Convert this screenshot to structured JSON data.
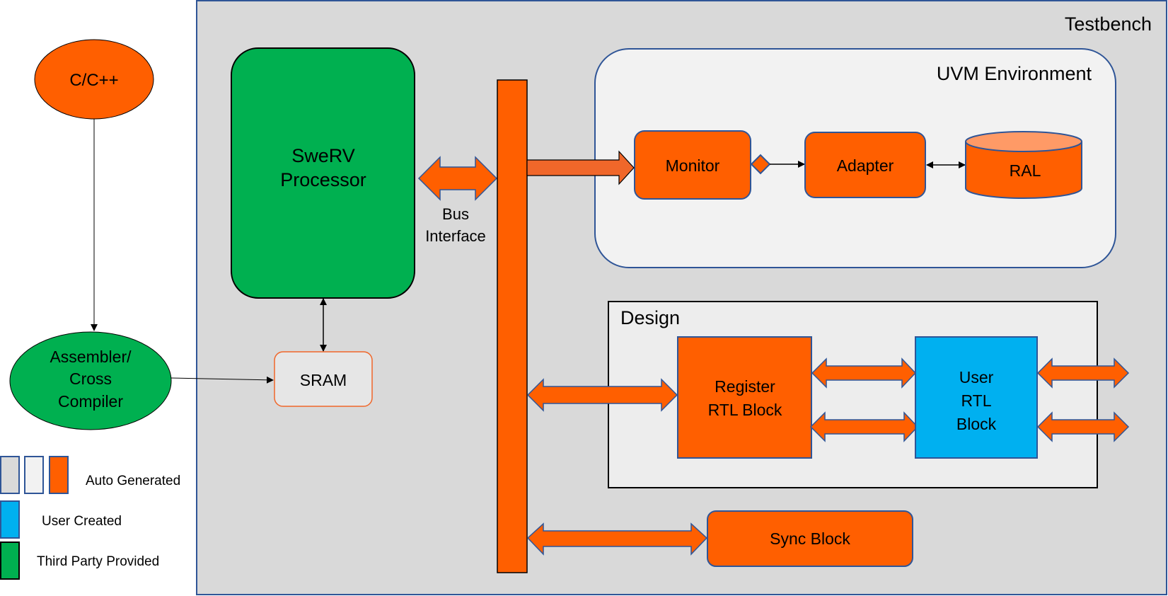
{
  "colors": {
    "orange": "#ff5f00",
    "green": "#00b050",
    "blue": "#00b0f0",
    "testbench_bg": "#d9d9d9",
    "uvm_bg": "#f2f2f2",
    "design_bg": "#ededed",
    "border_blue": "#2f5597"
  },
  "testbench": {
    "title": "Testbench"
  },
  "uvm": {
    "title": "UVM Environment",
    "monitor": "Monitor",
    "adapter": "Adapter",
    "ral": "RAL"
  },
  "processor": {
    "line1": "SweRV",
    "line2": "Processor"
  },
  "bus": {
    "line1": "Bus",
    "line2": "Interface"
  },
  "sram": {
    "label": "SRAM"
  },
  "source": {
    "label": "C/C++"
  },
  "compiler": {
    "line1": "Assembler/",
    "line2": "Cross",
    "line3": "Compiler"
  },
  "design": {
    "title": "Design",
    "register_line1": "Register",
    "register_line2": "RTL Block",
    "user_line1": "User",
    "user_line2": "RTL",
    "user_line3": "Block"
  },
  "sync": {
    "label": "Sync Block"
  },
  "legend": {
    "auto": "Auto Generated",
    "user": "User Created",
    "third": "Third Party Provided"
  }
}
